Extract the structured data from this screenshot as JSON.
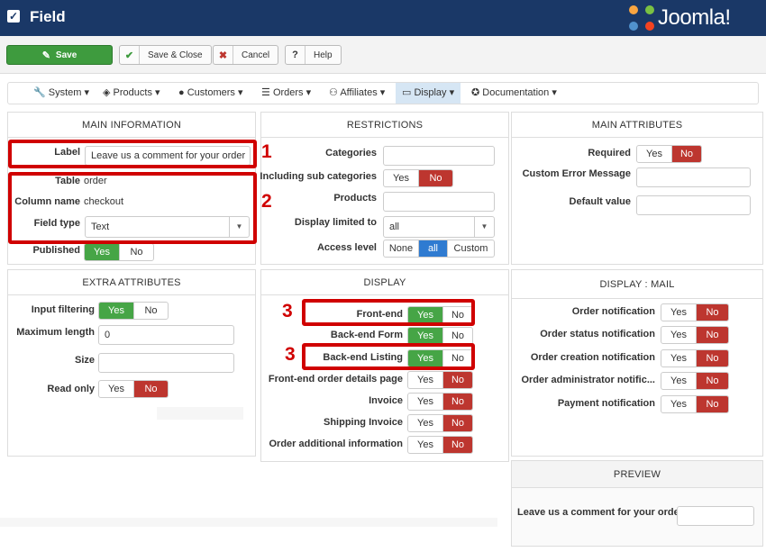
{
  "app": {
    "title": "Field",
    "logo_text": "Joomla!"
  },
  "toolbar": {
    "save": "Save",
    "save_close": "Save & Close",
    "cancel": "Cancel",
    "help": "Help"
  },
  "menu": [
    {
      "label": "System",
      "icon": "wrench-icon"
    },
    {
      "label": "Products",
      "icon": "cubes-icon"
    },
    {
      "label": "Customers",
      "icon": "user-icon"
    },
    {
      "label": "Orders",
      "icon": "list-icon"
    },
    {
      "label": "Affiliates",
      "icon": "users-icon"
    },
    {
      "label": "Display",
      "icon": "monitor-icon"
    },
    {
      "label": "Documentation",
      "icon": "lifebuoy-icon"
    }
  ],
  "main_info": {
    "heading": "MAIN INFORMATION",
    "label_label": "Label",
    "label_value": "Leave us a comment for your order",
    "table_label": "Table",
    "table_value": "order",
    "column_label": "Column name",
    "column_value": "checkout",
    "type_label": "Field type",
    "type_value": "Text",
    "published_label": "Published",
    "yes": "Yes",
    "no": "No"
  },
  "restrictions": {
    "heading": "RESTRICTIONS",
    "categories": "Categories",
    "sub_categories": "Including sub categories",
    "products": "Products",
    "display_limited": "Display limited to",
    "display_limited_value": "all",
    "access_level": "Access level",
    "access_options": [
      "None",
      "all",
      "Custom"
    ],
    "yes": "Yes",
    "no": "No"
  },
  "main_attributes": {
    "heading": "MAIN ATTRIBUTES",
    "required": "Required",
    "custom_error": "Custom Error Message",
    "default_value": "Default value",
    "yes": "Yes",
    "no": "No"
  },
  "extra_attributes": {
    "heading": "EXTRA ATTRIBUTES",
    "input_filtering": "Input filtering",
    "max_length": "Maximum length",
    "max_length_value": "0",
    "size": "Size",
    "read_only": "Read only",
    "yes": "Yes",
    "no": "No"
  },
  "display": {
    "heading": "DISPLAY",
    "rows": [
      {
        "label": "Front-end",
        "yes": "Yes",
        "no": "No",
        "state": "yes"
      },
      {
        "label": "Back-end Form",
        "yes": "Yes",
        "no": "No",
        "state": "yes"
      },
      {
        "label": "Back-end Listing",
        "yes": "Yes",
        "no": "No",
        "state": "yes"
      },
      {
        "label": "Front-end order details page",
        "yes": "Yes",
        "no": "No",
        "state": "no"
      },
      {
        "label": "Invoice",
        "yes": "Yes",
        "no": "No",
        "state": "no"
      },
      {
        "label": "Shipping Invoice",
        "yes": "Yes",
        "no": "No",
        "state": "no"
      },
      {
        "label": "Order additional information",
        "yes": "Yes",
        "no": "No",
        "state": "no"
      }
    ]
  },
  "display_mail": {
    "heading": "DISPLAY : MAIL",
    "rows": [
      {
        "label": "Order notification",
        "yes": "Yes",
        "no": "No"
      },
      {
        "label": "Order status notification",
        "yes": "Yes",
        "no": "No"
      },
      {
        "label": "Order creation notification",
        "yes": "Yes",
        "no": "No"
      },
      {
        "label": "Order administrator notific...",
        "yes": "Yes",
        "no": "No"
      },
      {
        "label": "Payment notification",
        "yes": "Yes",
        "no": "No"
      }
    ]
  },
  "preview": {
    "heading": "PREVIEW",
    "label": "Leave us a comment for your order"
  },
  "annotations": [
    "1",
    "2",
    "3",
    "3"
  ],
  "colors": {
    "header": "#1a3867",
    "green": "#46a546",
    "red": "#bd362f",
    "blue": "#2f7bd1",
    "annotation": "#d00000"
  }
}
